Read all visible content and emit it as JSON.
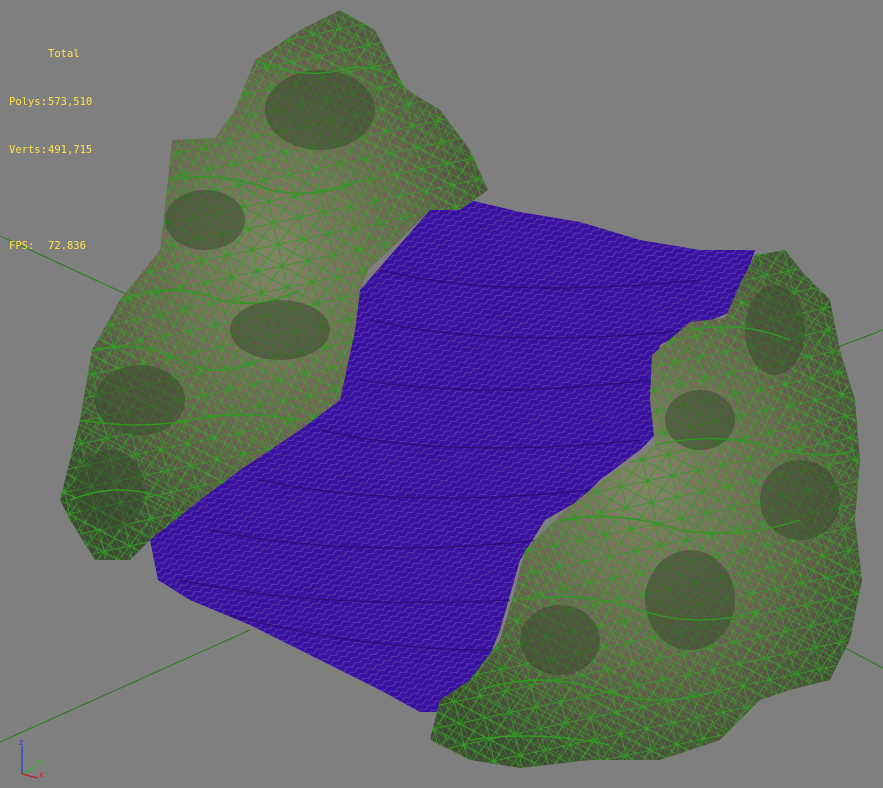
{
  "stats": {
    "header": "Total",
    "polys_label": "Polys:",
    "polys_value": "573,510",
    "verts_label": "Verts:",
    "verts_value": "491,715",
    "fps_label": "FPS:",
    "fps_value": "72.836"
  },
  "axis_gizmo": {
    "x_label": "x",
    "y_label": "y",
    "z_label": "z"
  },
  "colors": {
    "background": "#7f7f7f",
    "grid_line": "#2b7a1e",
    "rock_wire": "#2e9a20",
    "rock_fill": "#6f6258",
    "water_fill": "#3a10a0",
    "water_wire": "#6a5aa8",
    "stats_text": "#ffe34a",
    "axis_x": "#d02020",
    "axis_y": "#20c020",
    "axis_z": "#2040e0"
  },
  "viewport": {
    "label": "3D perspective viewport"
  }
}
